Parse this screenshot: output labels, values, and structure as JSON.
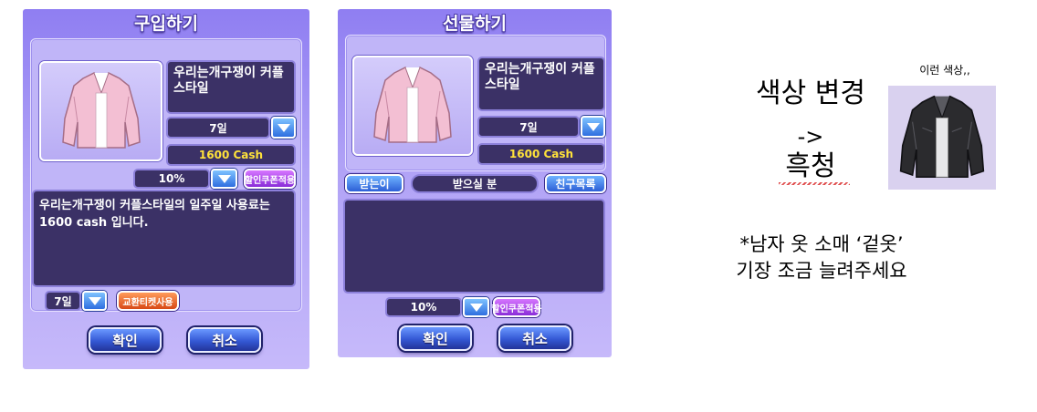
{
  "buy_dialog": {
    "title": "구입하기",
    "item_name": "우리는개구쟁이 커플스타일",
    "period": "7일",
    "price": "1600 Cash",
    "discount": "10%",
    "coupon_label": "할인쿠폰적용",
    "description": "우리는개구쟁이 커플스타일의 일주일 사용료는 1600 cash 입니다.",
    "ticket_period": "7일",
    "ticket_label": "교환티켓사용",
    "confirm_label": "확인",
    "cancel_label": "취소"
  },
  "gift_dialog": {
    "title": "선물하기",
    "item_name": "우리는개구쟁이 커플스타일",
    "period": "7일",
    "price": "1600 Cash",
    "recipient_label": "받는이",
    "recipient_value": "받으실 분",
    "friend_list_label": "친구목록",
    "discount": "10%",
    "coupon_label": "할인쿠폰적용",
    "confirm_label": "확인",
    "cancel_label": "취소"
  },
  "annotations": {
    "color_change_line1": "색상 변경",
    "color_change_arrow": "->",
    "color_change_line2": "흑청",
    "sample_caption": "이런 색상,,",
    "request_line1": "*남자 옷 소매 ‘겉옷’",
    "request_line2": "기장 조금 늘려주세요"
  },
  "colors": {
    "panel_top": "#8f7ef2",
    "dark_field": "#3b3166",
    "price_text": "#ffe23a",
    "jacket_pink": "#f3bfd3",
    "jacket_black": "#2b2b2e"
  }
}
